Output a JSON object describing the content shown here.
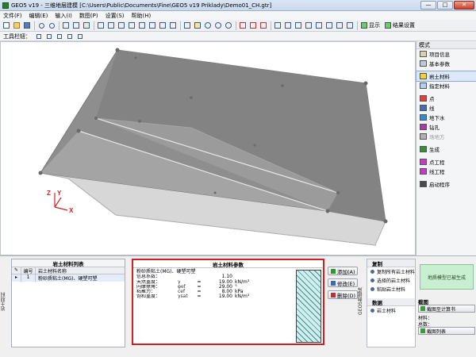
{
  "title": "GEO5 v19 - 三维地层建模 [C:\\Users\\Public\\Documents\\Fine\\GEO5 v19 Priklady\\Demo01_CH.gtr]",
  "window_buttons": {
    "minimize": "—",
    "maximize": "□",
    "close": "✕"
  },
  "menu": [
    "文件(F)",
    "编辑(E)",
    "输入(I)",
    "数图(P)",
    "设置(S)",
    "帮助(H)"
  ],
  "toolbar": {
    "display_label": "显示",
    "results_label": "结果设置"
  },
  "subtoolbar": {
    "label": "工具栏钮："
  },
  "axes": {
    "x": "X",
    "y": "Y",
    "z": "Z"
  },
  "frames": {
    "header": "模式",
    "items": [
      {
        "label": "项目信息",
        "enabled": true,
        "selected": false
      },
      {
        "label": "基本参数",
        "enabled": true,
        "selected": false
      },
      {
        "gap": true
      },
      {
        "label": "岩土材料",
        "enabled": true,
        "selected": true
      },
      {
        "label": "指定材料",
        "enabled": true,
        "selected": false
      },
      {
        "gap": true
      },
      {
        "label": "点",
        "enabled": true,
        "selected": false
      },
      {
        "label": "线",
        "enabled": true,
        "selected": false
      },
      {
        "label": "地下水",
        "enabled": true,
        "selected": false
      },
      {
        "label": "钻孔",
        "enabled": true,
        "selected": false
      },
      {
        "label": "场地方",
        "enabled": false,
        "selected": false
      },
      {
        "gap": true
      },
      {
        "label": "生成",
        "enabled": true,
        "selected": false
      },
      {
        "gap": true
      },
      {
        "label": "点工程",
        "enabled": true,
        "selected": false
      },
      {
        "label": "线工程",
        "enabled": true,
        "selected": false
      },
      {
        "gap": true
      },
      {
        "label": "启动程序",
        "enabled": true,
        "selected": false
      }
    ]
  },
  "bottom": {
    "left_tab": "岩土材料",
    "soils_list": {
      "title": "岩土材料列表",
      "columns": [
        "编号",
        "岩土材料名称"
      ],
      "rows": [
        {
          "no": "1",
          "name": "粉砂质粘土(MG)、硬塑可塑"
        }
      ]
    },
    "soil_params": {
      "title": "岩土材料参数",
      "name": "粉砂质粘土(MG)、硬塑可塑",
      "rows": [
        {
          "name": "信息系数：",
          "symbol": "",
          "value": "1.10",
          "unit": ""
        },
        {
          "name": "天然重度：",
          "symbol": "γ",
          "value": "19.00",
          "unit": "kN/m³"
        },
        {
          "name": "内摩擦角：",
          "symbol": "φef",
          "value": "29.00",
          "unit": "°"
        },
        {
          "name": "粘聚力：",
          "symbol": "cef",
          "value": "8.00",
          "unit": "kPa"
        },
        {
          "name": "饱和重度：",
          "symbol": "γsat",
          "value": "19.00",
          "unit": "kN/m³"
        }
      ]
    },
    "actions": {
      "add": "添加(A)",
      "edit": "修改(E)",
      "delete": "删除(D)"
    },
    "geo_tab": "GEO5数据库",
    "copy": {
      "section1": "复制",
      "items1": [
        "复制所有岩土材料",
        "选择的岩土材料",
        "粘贴岩土材料"
      ],
      "section2": "数据",
      "items2": [
        "岩土材料"
      ]
    },
    "info": "地质模型已被生成",
    "calc": {
      "label": "截图",
      "button": "截图至计算书",
      "line1": "材料：",
      "line2": "总数：",
      "button2": "截图列表"
    }
  }
}
